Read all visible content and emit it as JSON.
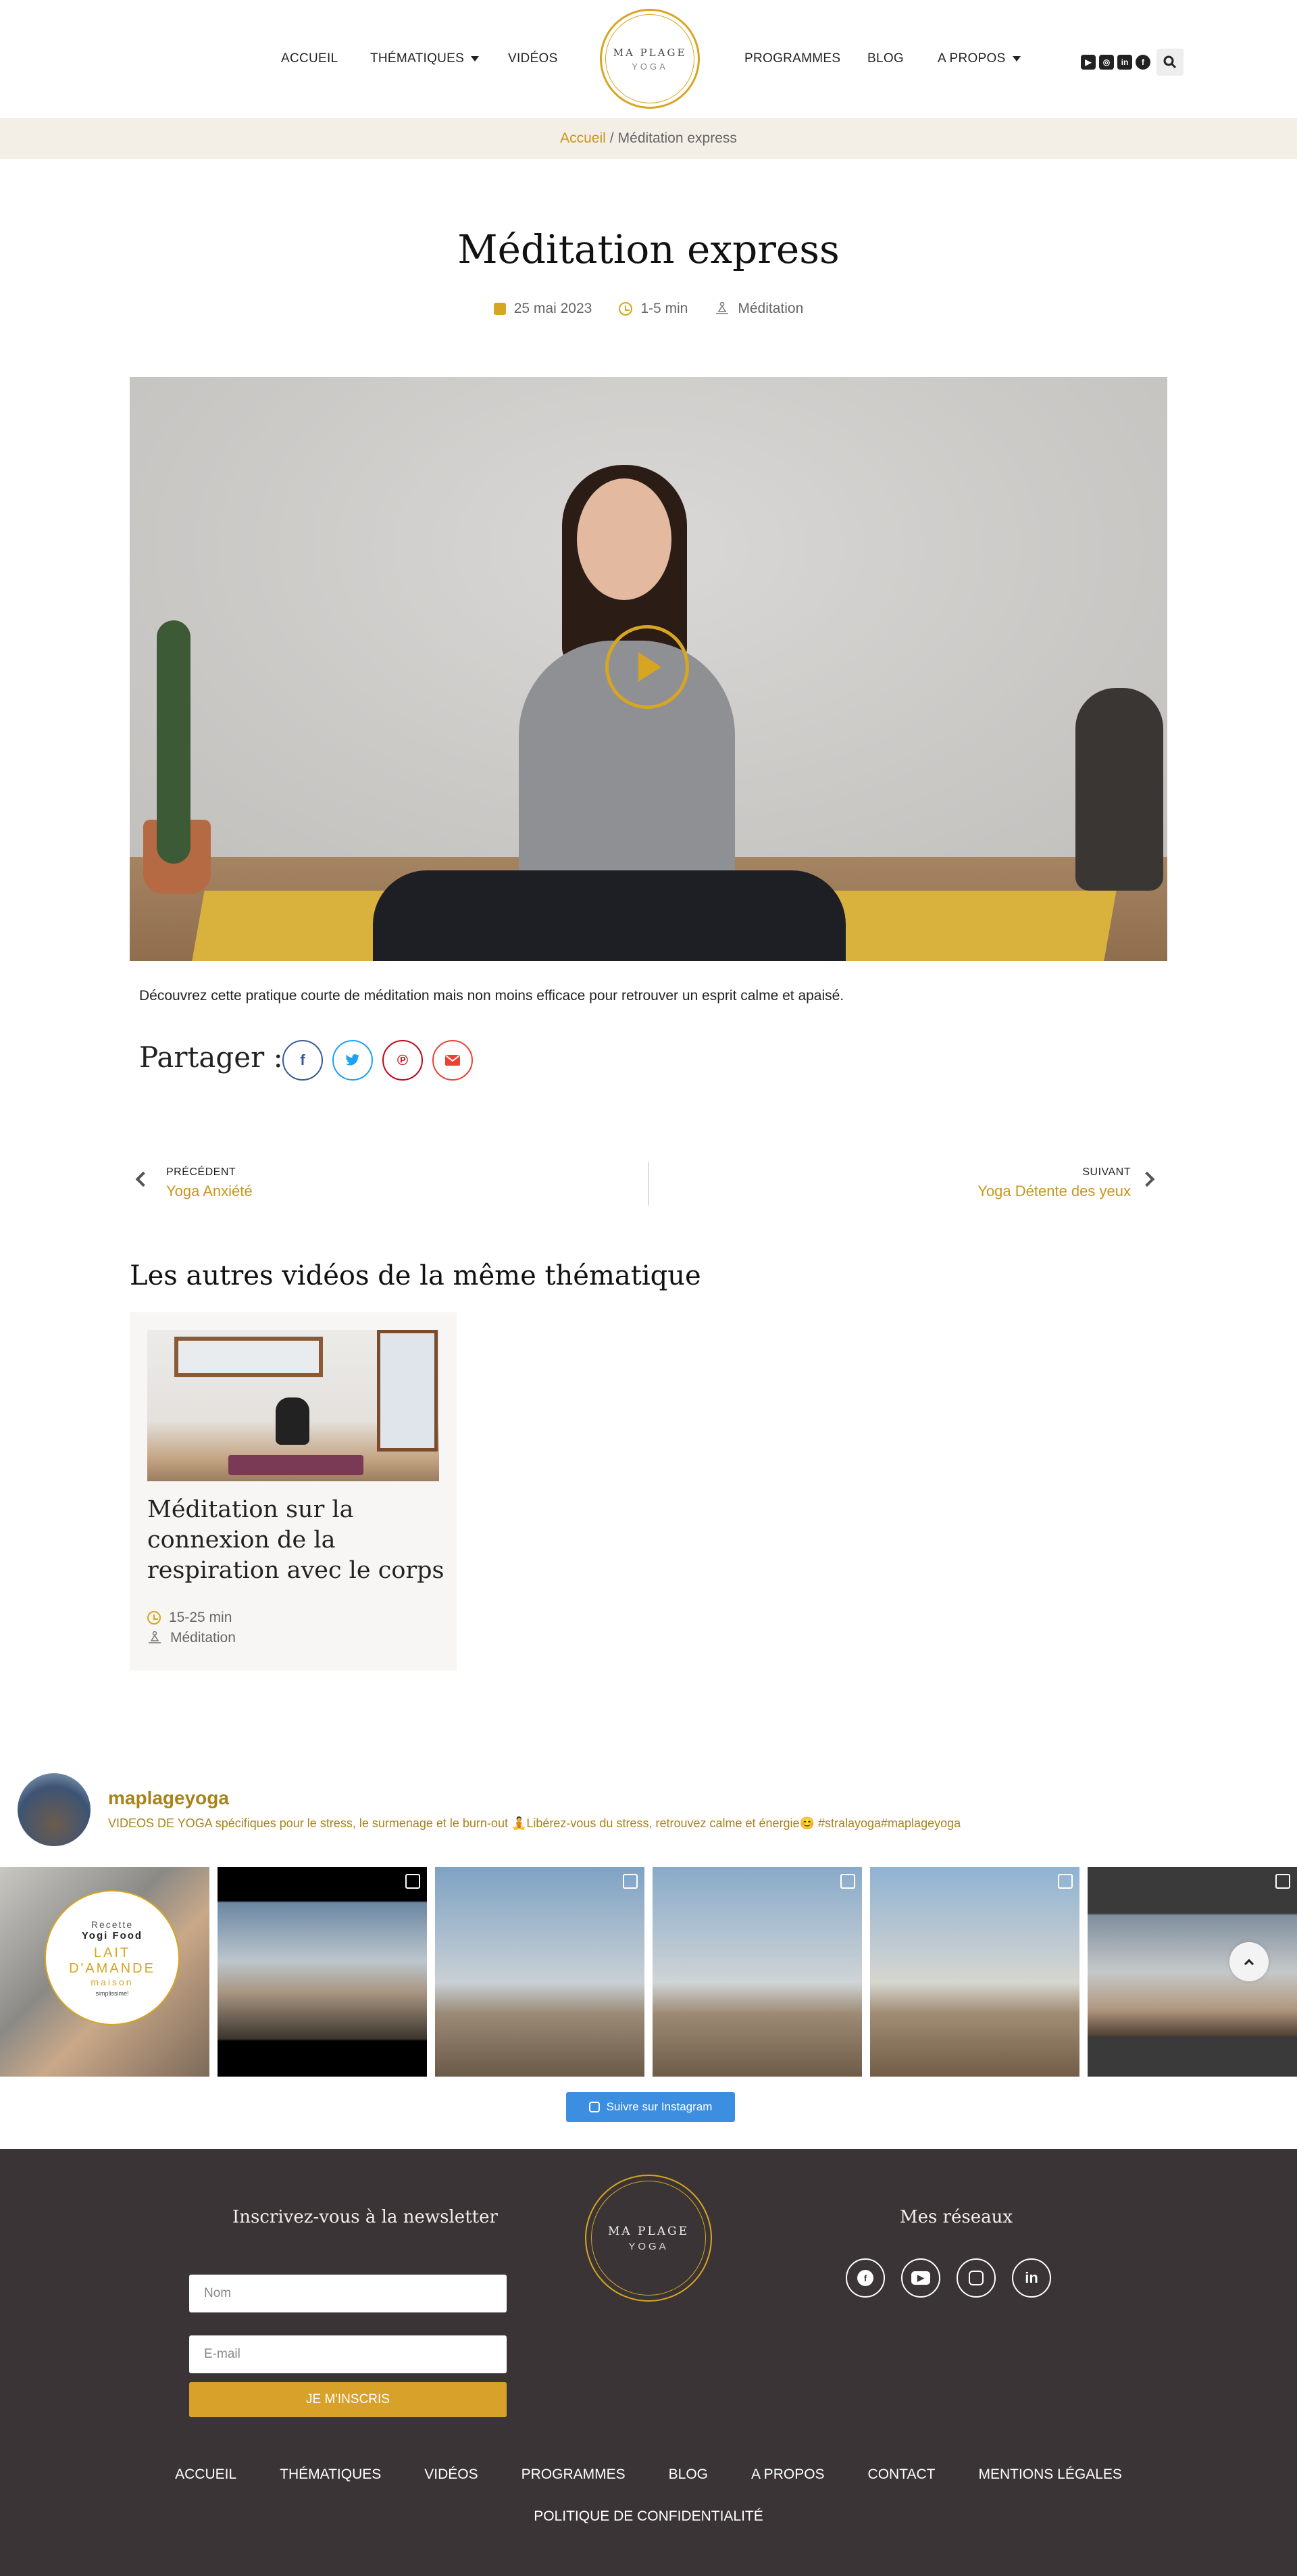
{
  "header": {
    "nav_left": [
      "Accueil",
      "Thématiques",
      "Vidéos"
    ],
    "nav_right": [
      "Programmes",
      "Blog",
      "A propos"
    ],
    "logo_line1": "MA PLAGE",
    "logo_line2": "YOGA"
  },
  "social_icons": [
    "youtube-icon",
    "instagram-icon",
    "linkedin-icon",
    "facebook-icon"
  ],
  "breadcrumb": {
    "home": "Accueil",
    "separator": "/",
    "current": "Méditation express"
  },
  "post": {
    "title": "Méditation express",
    "date": "25 mai 2023",
    "duration": "1-5 min",
    "category": "Méditation",
    "description": "Découvrez cette pratique courte de méditation mais non moins efficace pour retrouver un esprit calme et apaisé."
  },
  "share": {
    "label": "Partager :",
    "buttons": [
      {
        "name": "facebook",
        "color": "#3b5998"
      },
      {
        "name": "twitter",
        "color": "#1da1f2"
      },
      {
        "name": "pinterest",
        "color": "#bd081c"
      },
      {
        "name": "email",
        "color": "#ea4335"
      }
    ]
  },
  "pagination": {
    "prev_label": "PRÉCÉDENT",
    "prev_title": "Yoga Anxiété",
    "next_label": "SUIVANT",
    "next_title": "Yoga Détente des yeux"
  },
  "related": {
    "heading": "Les autres vidéos de la même thématique",
    "cards": [
      {
        "title": "Méditation sur la connexion de la respiration avec le corps",
        "duration": "15-25 min",
        "category": "Méditation"
      }
    ]
  },
  "instagram": {
    "username": "maplageyoga",
    "bio": "VIDEOS DE YOGA spécifiques pour le stress, le surmenage et le burn-out 🧘Libérez-vous du stress, retrouvez calme et énergie😊 #stralayoga#maplageyoga",
    "first_post": {
      "line1": "Recette",
      "line2": "Yogi Food",
      "line3": "LAIT",
      "line4": "D'AMANDE",
      "line5": "maison",
      "line6": "simplissime!"
    },
    "follow_label": "Suivre sur Instagram"
  },
  "footer": {
    "newsletter_heading": "Inscrivez-vous à la newsletter",
    "name_placeholder": "Nom",
    "email_placeholder": "E-mail",
    "submit_label": "Je m'inscris",
    "networks_heading": "Mes réseaux",
    "logo_line1": "MA PLAGE",
    "logo_line2": "YOGA",
    "nav": [
      "Accueil",
      "Thématiques",
      "Vidéos",
      "Programmes",
      "Blog",
      "A propos",
      "Contact",
      "Mentions légales"
    ],
    "nav2": "Politique de confidentialité"
  },
  "colors": {
    "accent": "#d7a521",
    "link": "#c9951a",
    "breadcrumb_bg": "#f3efe7",
    "footer_bg": "#3a3436",
    "instagram_follow": "#3b8ee0"
  }
}
